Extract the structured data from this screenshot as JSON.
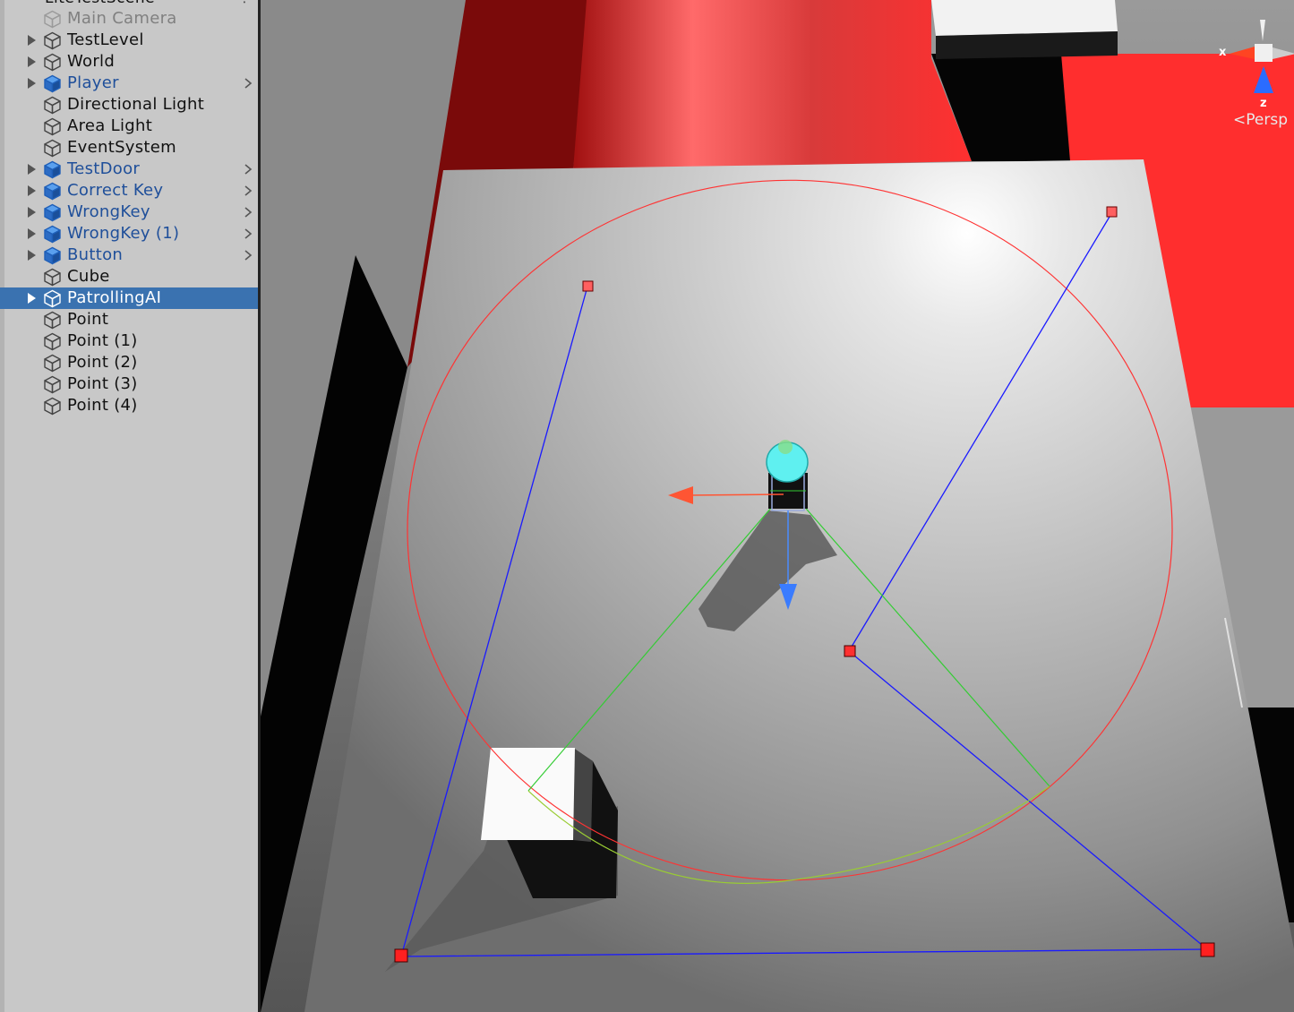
{
  "hierarchy": {
    "scene_name": "LiteTestScene",
    "items": [
      {
        "label": "Main Camera",
        "type": "gameobject",
        "disabled": true
      },
      {
        "label": "TestLevel",
        "type": "gameobject",
        "foldout": true
      },
      {
        "label": "World",
        "type": "gameobject",
        "foldout": true
      },
      {
        "label": "Player",
        "type": "prefab",
        "foldout": true,
        "chevron": true
      },
      {
        "label": "Directional Light",
        "type": "gameobject"
      },
      {
        "label": "Area Light",
        "type": "gameobject"
      },
      {
        "label": "EventSystem",
        "type": "gameobject"
      },
      {
        "label": "TestDoor",
        "type": "prefab",
        "foldout": true,
        "chevron": true
      },
      {
        "label": "Correct Key",
        "type": "prefab",
        "foldout": true,
        "chevron": true
      },
      {
        "label": "WrongKey",
        "type": "prefab",
        "foldout": true,
        "chevron": true
      },
      {
        "label": "WrongKey (1)",
        "type": "prefab",
        "foldout": true,
        "chevron": true
      },
      {
        "label": "Button",
        "type": "prefab",
        "foldout": true,
        "chevron": true
      },
      {
        "label": "Cube",
        "type": "gameobject"
      },
      {
        "label": "PatrollingAI",
        "type": "gameobject",
        "foldout": true,
        "selected": true
      },
      {
        "label": "Point",
        "type": "gameobject"
      },
      {
        "label": "Point (1)",
        "type": "gameobject"
      },
      {
        "label": "Point (2)",
        "type": "gameobject"
      },
      {
        "label": "Point (3)",
        "type": "gameobject"
      },
      {
        "label": "Point (4)",
        "type": "gameobject"
      }
    ]
  },
  "scene_view": {
    "gizmo": {
      "x_label": "x",
      "z_label": "z",
      "projection_label": "Persp"
    },
    "colors": {
      "selection": "#3a72b0",
      "prefab_text": "#1f4f9a",
      "detection_radius": "#ff3333",
      "patrol_path": "#1a1aff",
      "view_cone": "#33cc33",
      "waypoint": "#ff3030"
    }
  }
}
